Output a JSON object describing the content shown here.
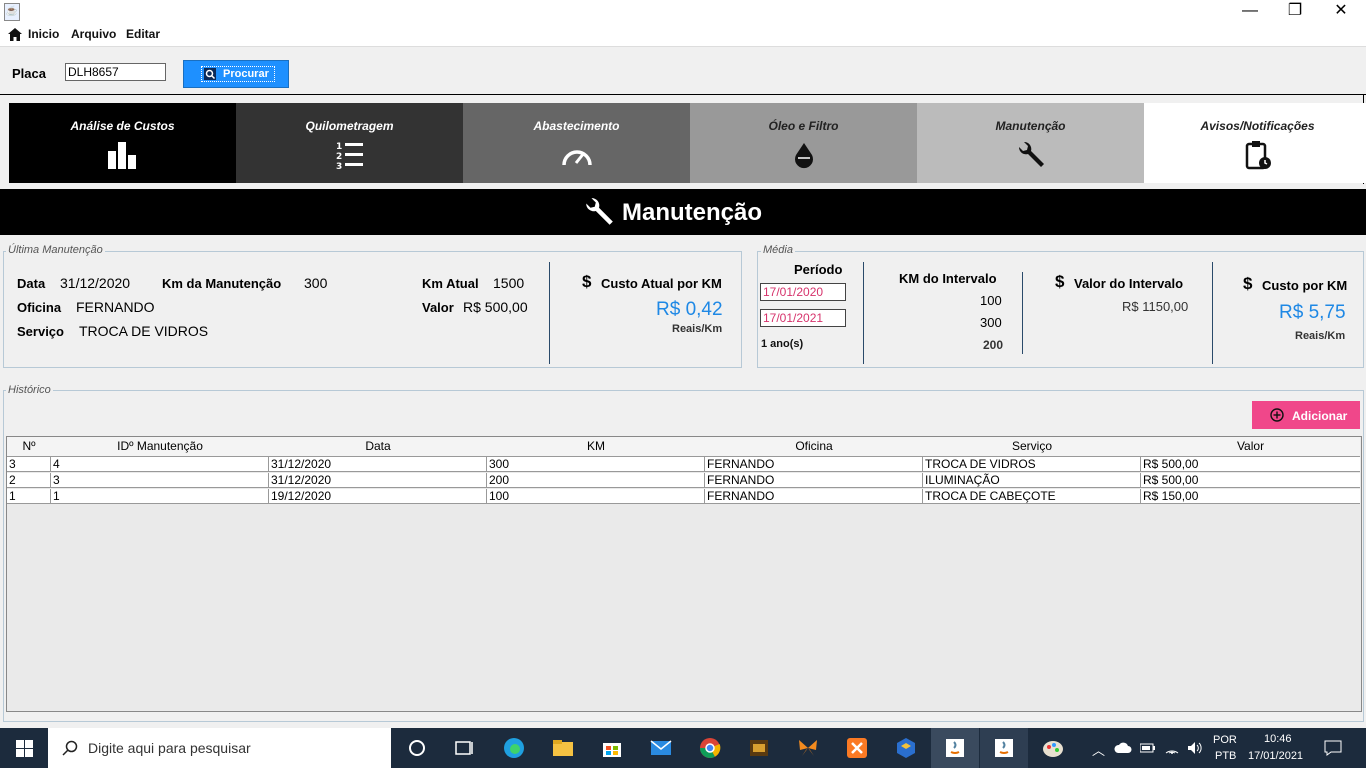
{
  "window": {
    "minimize": "—",
    "maximize": "❐",
    "close": "✕"
  },
  "menu": {
    "inicio": "Inicio",
    "arquivo": "Arquivo",
    "editar": "Editar"
  },
  "placa": {
    "label": "Placa",
    "value": "DLH8657",
    "search_label": "Procurar"
  },
  "tabs": [
    {
      "label": "Análise de Custos",
      "bg": "#000000",
      "color": "#ffffff",
      "icon": "bar-chart-icon"
    },
    {
      "label": "Quilometragem",
      "bg": "#333333",
      "color": "#ffffff",
      "icon": "numbered-list-icon"
    },
    {
      "label": "Abastecimento",
      "bg": "#666666",
      "color": "#ffffff",
      "icon": "speedometer-icon"
    },
    {
      "label": "Óleo e Filtro",
      "bg": "#999999",
      "color": "#222222",
      "icon": "oil-drop-icon"
    },
    {
      "label": "Manutenção",
      "bg": "#bbbbbb",
      "color": "#222222",
      "icon": "wrench-icon"
    },
    {
      "label": "Avisos/Notificações",
      "bg": "#ffffff",
      "color": "#222222",
      "icon": "clipboard-clock-icon"
    }
  ],
  "header": {
    "title": "Manutenção",
    "icon": "wrench-icon"
  },
  "ultima": {
    "legend": "Última Manutenção",
    "data_label": "Data",
    "data_value": "31/12/2020",
    "km_manut_label": "Km da Manutenção",
    "km_manut_value": "300",
    "oficina_label": "Oficina",
    "oficina_value": "FERNANDO",
    "servico_label": "Serviço",
    "servico_value": "TROCA DE VIDROS",
    "km_atual_label": "Km Atual",
    "km_atual_value": "1500",
    "valor_label": "Valor",
    "valor_value": "R$ 500,00",
    "custo_label": "Custo Atual por KM",
    "custo_value": "R$ 0,42",
    "custo_unit": "Reais/Km"
  },
  "media": {
    "legend": "Média",
    "periodo_label": "Período",
    "date_from": "17/01/2020",
    "date_to": "17/01/2021",
    "periodo_text": "1 ano(s)",
    "km_intervalo_label": "KM do Intervalo",
    "km_values": [
      "100",
      "300",
      "200"
    ],
    "valor_intervalo_label": "Valor do Intervalo",
    "valor_intervalo_value": "R$ 1150,00",
    "custo_km_label": "Custo por KM",
    "custo_km_value": "R$ 5,75",
    "custo_km_unit": "Reais/Km"
  },
  "historico": {
    "legend": "Histórico",
    "add_label": "Adicionar",
    "columns": [
      "Nº",
      "IDº Manutenção",
      "Data",
      "KM",
      "Oficina",
      "Serviço",
      "Valor"
    ],
    "rows": [
      [
        "3",
        "4",
        "31/12/2020",
        "300",
        "FERNANDO",
        "TROCA DE VIDROS",
        "R$ 500,00"
      ],
      [
        "2",
        "3",
        "31/12/2020",
        "200",
        "FERNANDO",
        "ILUMINAÇÃO",
        "R$ 500,00"
      ],
      [
        "1",
        "1",
        "19/12/2020",
        "100",
        "FERNANDO",
        "TROCA DE CABEÇOTE",
        "R$ 150,00"
      ]
    ]
  },
  "taskbar": {
    "search_placeholder": "Digite aqui para pesquisar",
    "lang1": "POR",
    "lang2": "PTB",
    "time": "10:46",
    "date": "17/01/2021"
  }
}
